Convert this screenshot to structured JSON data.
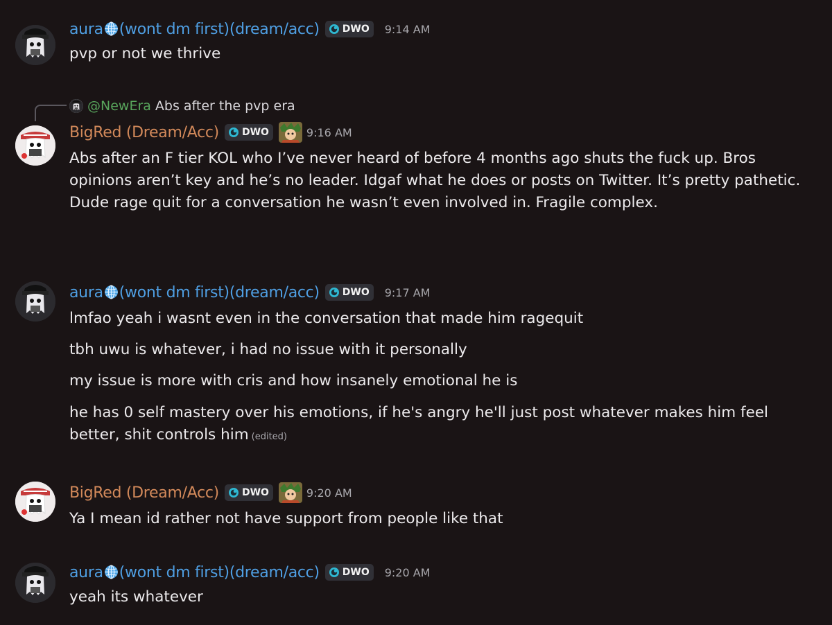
{
  "messages": [
    {
      "author": "aura",
      "author_suffix": "(wont dm first)(dream/acc)",
      "tag": "DWO",
      "time": "9:14 AM",
      "lines": [
        "pvp or not we thrive"
      ]
    },
    {
      "reply": {
        "mention": "@NewEra",
        "text": "Abs after the pvp era"
      },
      "author": "BigRed (Dream/Acc)",
      "tag": "DWO",
      "time": "9:16 AM",
      "lines": [
        "Abs after an F tier KOL who I’ve never heard of before 4 months ago shuts the fuck up. Bros opinions aren’t key and he’s no leader. Idgaf what he does or posts on Twitter. It’s pretty pathetic. Dude rage quit for a conversation he wasn’t even involved in. Fragile complex."
      ]
    },
    {
      "author": "aura",
      "author_suffix": "(wont dm first)(dream/acc)",
      "tag": "DWO",
      "time": "9:17 AM",
      "lines": [
        "lmfao yeah i wasnt even in the conversation that made him ragequit",
        "tbh uwu is whatever, i had no issue with it personally",
        "my issue is more with cris and how insanely emotional he is",
        "he has 0 self mastery over his emotions, if he's angry he'll just post whatever makes him feel better, shit controls him"
      ],
      "edited": "(edited)"
    },
    {
      "author": "BigRed (Dream/Acc)",
      "tag": "DWO",
      "time": "9:20 AM",
      "lines": [
        "Ya I mean id rather not have support from people like that"
      ]
    },
    {
      "author": "aura",
      "author_suffix": "(wont dm first)(dream/acc)",
      "tag": "DWO",
      "time": "9:20 AM",
      "lines": [
        "yeah its whatever"
      ]
    }
  ],
  "colors": {
    "background": "#1a1415",
    "aura_name": "#4f9fe3",
    "bigred_name": "#d2895a",
    "mention": "#58a55c",
    "timestamp": "#a9a8ad"
  },
  "icons": [
    "globe-icon",
    "dwo-tag-icon",
    "decoration-badge-icon",
    "reply-spine"
  ]
}
